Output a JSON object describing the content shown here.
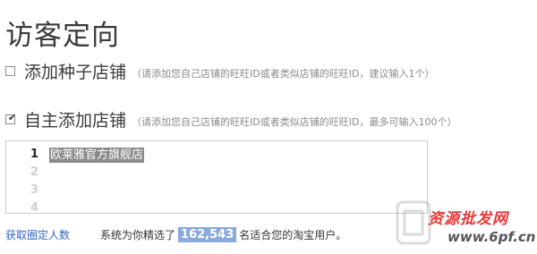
{
  "page": {
    "title": "访客定向"
  },
  "options": [
    {
      "label": "添加种子店铺",
      "hint": "（请添加您自己店铺的旺旺ID或者类似店铺的旺旺ID，建议输入1个）",
      "checked": false
    },
    {
      "label": "自主添加店铺",
      "hint": "（请添加您自己店铺的旺旺ID或者类似店铺的旺旺ID，最多可输入100个）",
      "checked": true
    }
  ],
  "editor": {
    "line_numbers": [
      "1",
      "2",
      "3",
      "4"
    ],
    "lines": [
      "欧莱雅官方旗舰店"
    ]
  },
  "footer": {
    "link_label": "获取圈定人数",
    "text_before": "系统为你精选了",
    "count": "162,543",
    "text_after": "名适合您的淘宝用户。"
  },
  "watermark": {
    "site_text": "资源批发网",
    "url_text": "www.6pf.cn",
    "icon": "watermark-logo-icon"
  }
}
